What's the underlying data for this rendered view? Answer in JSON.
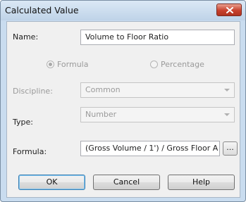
{
  "window": {
    "title": "Calculated Value"
  },
  "form": {
    "name_label": "Name:",
    "name_value": "Volume to Floor Ratio",
    "radio_formula": "Formula",
    "radio_percentage": "Percentage",
    "discipline_label": "Discipline:",
    "discipline_value": "Common",
    "type_label": "Type:",
    "type_value": "Number",
    "formula_label": "Formula:",
    "formula_value": "(Gross Volume / 1') / Gross Floor A",
    "formula_button": "..."
  },
  "buttons": {
    "ok": "OK",
    "cancel": "Cancel",
    "help": "Help"
  },
  "icons": {
    "close": "close-icon"
  },
  "colors": {
    "close_button": "#c8412e",
    "frame": "#c9dcef"
  }
}
